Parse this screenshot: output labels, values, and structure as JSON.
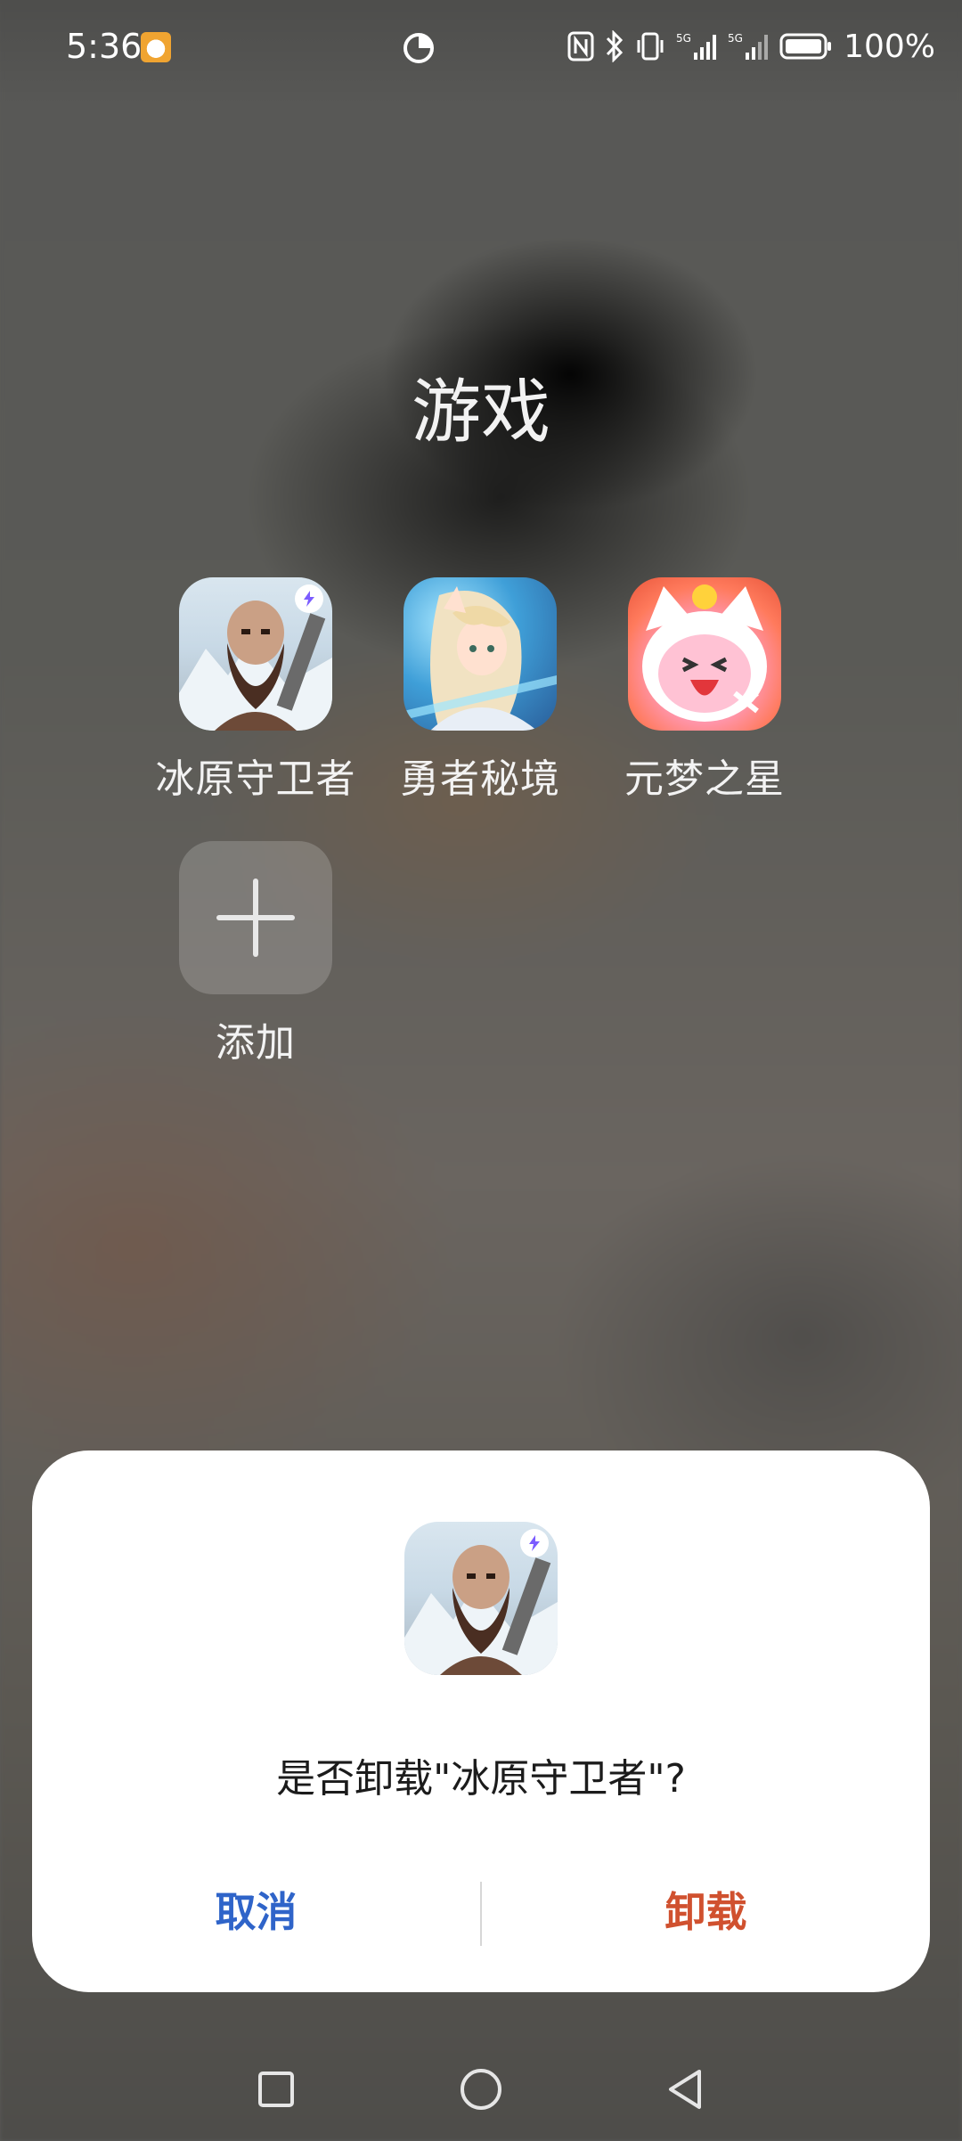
{
  "status_bar": {
    "time": "5:36",
    "battery_percent": "100%",
    "icons": [
      "app-notification-icon",
      "data-saver-icon",
      "nfc-icon",
      "bluetooth-icon",
      "vibrate-icon",
      "signal-5g-1-icon",
      "signal-5g-2-icon",
      "battery-icon"
    ]
  },
  "folder": {
    "title": "游戏",
    "apps": [
      {
        "label": "冰原守卫者",
        "icon": "binyuan-shouweizhe-icon"
      },
      {
        "label": "勇者秘境",
        "icon": "yongzhe-mijing-icon"
      },
      {
        "label": "元梦之星",
        "icon": "yuanmeng-zhixing-icon"
      }
    ],
    "add_label": "添加"
  },
  "dialog": {
    "message": "是否卸载\"冰原守卫者\"?",
    "cancel_label": "取消",
    "uninstall_label": "卸载",
    "cancel_color": "#2f64c9",
    "uninstall_color": "#d0512f"
  },
  "nav_bar": {
    "buttons": [
      "recents-square-icon",
      "home-circle-icon",
      "back-triangle-icon"
    ]
  }
}
